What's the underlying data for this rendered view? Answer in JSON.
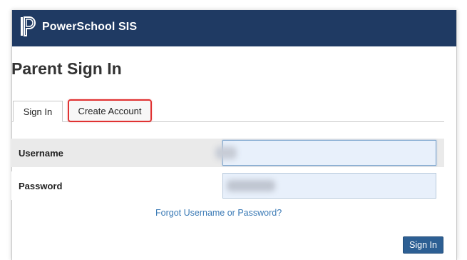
{
  "header": {
    "brand": "PowerSchool SIS",
    "logo_icon": "powerschool-logo-icon",
    "background": "#1f3a63"
  },
  "page": {
    "title": "Parent Sign In"
  },
  "tabs": [
    {
      "label": "Sign In",
      "selected": true
    },
    {
      "label": "Create Account",
      "selected": false,
      "highlight": "#e03232"
    }
  ],
  "form": {
    "username_label": "Username",
    "password_label": "Password",
    "username_value": "",
    "password_value": ""
  },
  "links": {
    "forgot": "Forgot Username or Password?"
  },
  "buttons": {
    "sign_in": "Sign In"
  }
}
